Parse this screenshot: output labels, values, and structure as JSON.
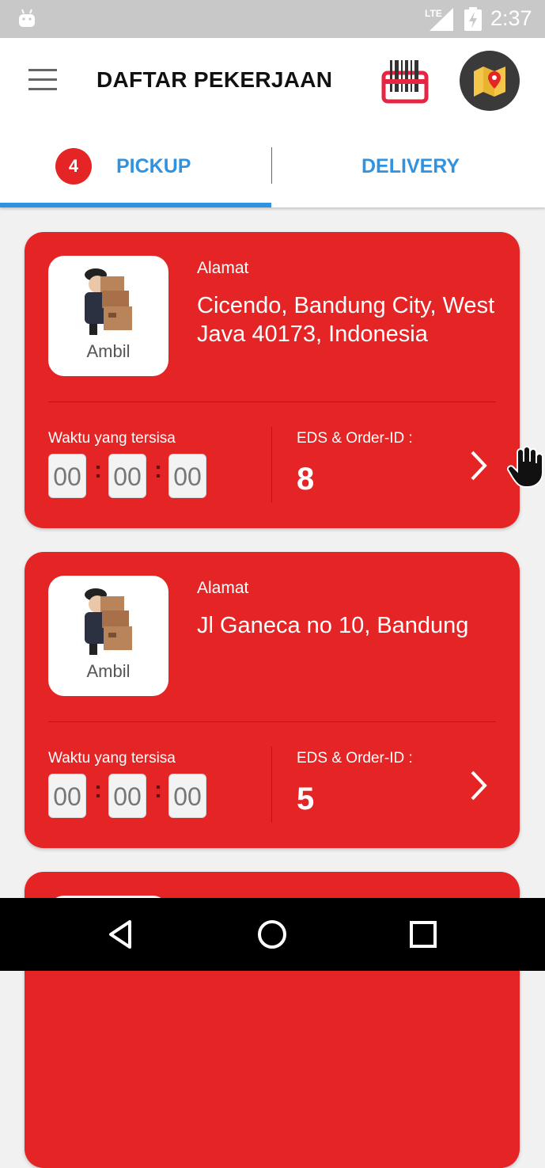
{
  "status_bar": {
    "network_label": "LTE",
    "time": "2:37"
  },
  "app_bar": {
    "title": "DAFTAR PEKERJAAN"
  },
  "tabs": {
    "pickup": {
      "label": "PICKUP",
      "badge": "4",
      "selected": true
    },
    "delivery": {
      "label": "DELIVERY"
    }
  },
  "cards": [
    {
      "thumb_label": "Ambil",
      "alamat_label": "Alamat",
      "address": "Cicendo, Bandung City, West Java 40173, Indonesia",
      "waktu_label": "Waktu yang tersisa",
      "time": {
        "h": "00",
        "m": "00",
        "s": "00"
      },
      "eds_label": "EDS & Order-ID :",
      "order_id": "8"
    },
    {
      "thumb_label": "Ambil",
      "alamat_label": "Alamat",
      "address": "Jl Ganeca no 10, Bandung",
      "waktu_label": "Waktu yang tersisa",
      "time": {
        "h": "00",
        "m": "00",
        "s": "00"
      },
      "eds_label": "EDS & Order-ID :",
      "order_id": "5"
    }
  ],
  "colors": {
    "card_red": "#e52525",
    "tab_blue": "#2f93e2",
    "status_gray": "#c8c8c8"
  }
}
